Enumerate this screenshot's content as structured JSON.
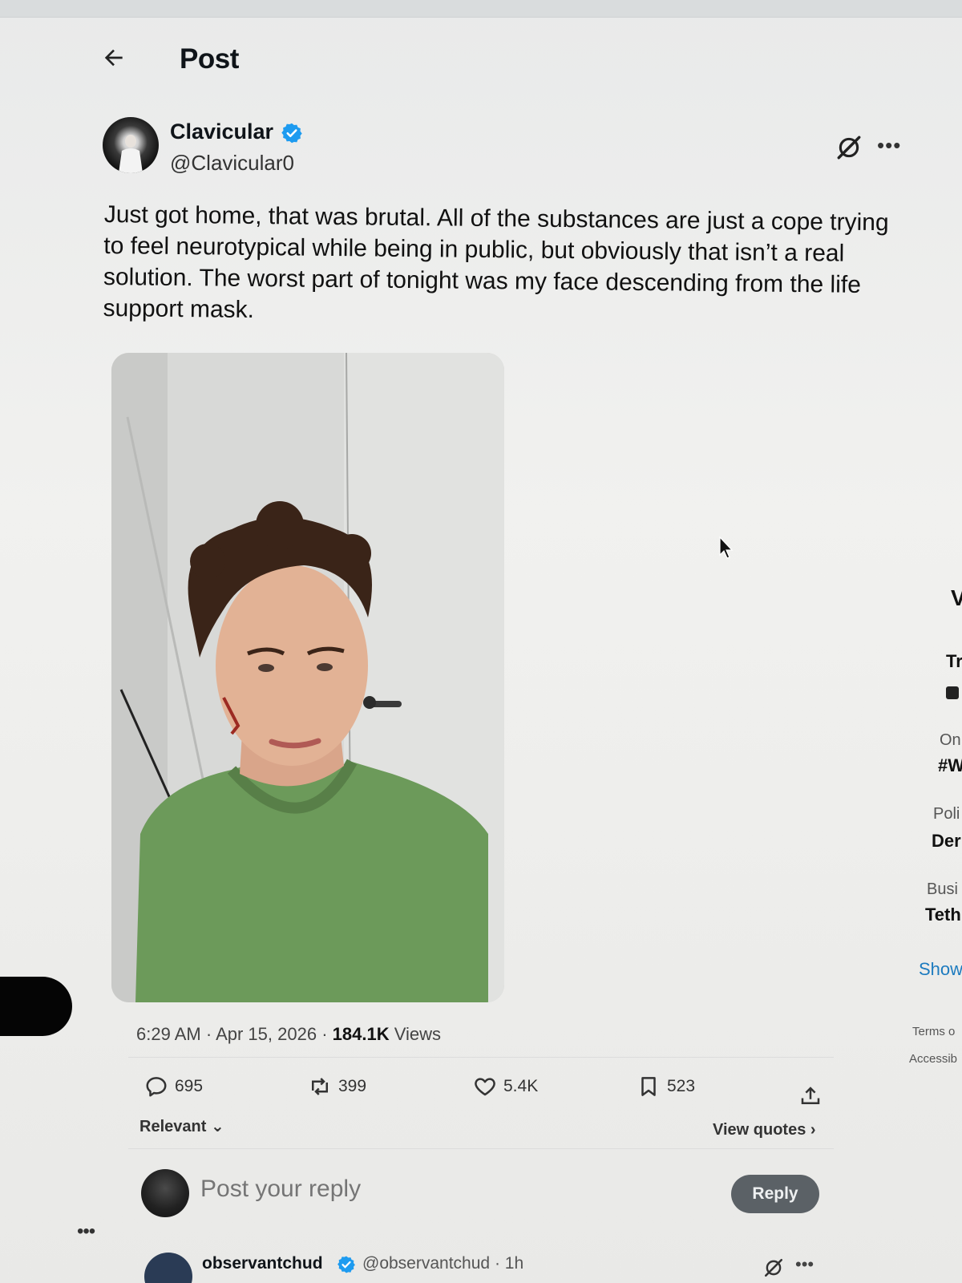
{
  "header": {
    "title": "Post"
  },
  "post": {
    "author_name": "Clavicular",
    "author_handle": "@Clavicular0",
    "text": "Just got home, that was brutal. All of the substances are just a cope trying to feel neurotypical while being in public, but obviously that isn’t a real solution. The worst part of tonight was my face descending from the life support mask.",
    "time": "6:29 AM",
    "separator": "·",
    "date": "Apr 15, 2026",
    "views_count": "184.1K",
    "views_label": "Views"
  },
  "actions": {
    "replies": "695",
    "reposts": "399",
    "likes": "5.4K",
    "bookmarks": "523"
  },
  "sort": {
    "label": "Relevant"
  },
  "view_quotes": {
    "label": "View quotes"
  },
  "composer": {
    "placeholder": "Post your reply",
    "button": "Reply"
  },
  "first_reply": {
    "author_name": "observantchud",
    "author_handle": "@observantchud",
    "time": "· 1h"
  },
  "right_sidebar": {
    "items": [
      "V",
      "Tr",
      "On",
      "#W",
      "Poli",
      "Der",
      "Busi",
      "Teth",
      "Show",
      "Terms o",
      "Accessib"
    ]
  },
  "colors": {
    "verified": "#1d9bf0",
    "reply_button": "#5b6166",
    "link": "#1d7bbf"
  },
  "icons": [
    "back-arrow-icon",
    "verified-badge-icon",
    "grok-icon",
    "more-icon",
    "reply-icon",
    "repost-icon",
    "like-icon",
    "bookmark-icon",
    "share-icon"
  ]
}
